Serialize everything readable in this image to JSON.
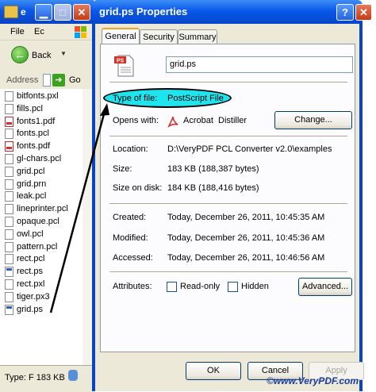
{
  "explorer": {
    "title": "e",
    "menu": [
      "File",
      "Ec"
    ],
    "back_label": "Back",
    "address_label": "Address",
    "go_label": "Go",
    "files": [
      {
        "name": "bitfonts.pxl",
        "icon": "doc"
      },
      {
        "name": "fills.pcl",
        "icon": "doc"
      },
      {
        "name": "fonts1.pdf",
        "icon": "pdf"
      },
      {
        "name": "fonts.pcl",
        "icon": "doc"
      },
      {
        "name": "fonts.pdf",
        "icon": "pdf"
      },
      {
        "name": "gl-chars.pcl",
        "icon": "doc"
      },
      {
        "name": "grid.pcl",
        "icon": "doc"
      },
      {
        "name": "grid.prn",
        "icon": "doc"
      },
      {
        "name": "leak.pcl",
        "icon": "doc"
      },
      {
        "name": "lineprinter.pcl",
        "icon": "doc"
      },
      {
        "name": "opaque.pcl",
        "icon": "doc"
      },
      {
        "name": "owl.pcl",
        "icon": "doc"
      },
      {
        "name": "pattern.pcl",
        "icon": "doc"
      },
      {
        "name": "rect.pcl",
        "icon": "doc"
      },
      {
        "name": "rect.ps",
        "icon": "ps"
      },
      {
        "name": "rect.pxl",
        "icon": "doc"
      },
      {
        "name": "tiger.px3",
        "icon": "doc"
      },
      {
        "name": "grid.ps",
        "icon": "ps"
      }
    ],
    "status": "Type: F 183 KB"
  },
  "dialog": {
    "title": "grid.ps Properties",
    "help_label": "?",
    "close_label": "✕",
    "tabs": [
      "General",
      "Security",
      "Summary"
    ],
    "active_tab": 0,
    "file_name": "grid.ps",
    "icon_badge": "PS",
    "type_label": "Type of file:",
    "type_value": "PostScript File",
    "opens_label": "Opens with:",
    "opens_value": "Acrobat  Distiller",
    "change_label": "Change...",
    "location_label": "Location:",
    "location_value": "D:\\VeryPDF PCL Converter v2.0\\examples",
    "size_label": "Size:",
    "size_value": "183 KB (188,387 bytes)",
    "size_disk_label": "Size on disk:",
    "size_disk_value": "184 KB (188,416 bytes)",
    "created_label": "Created:",
    "created_value": "Today, December 26, 2011, 10:45:35 AM",
    "modified_label": "Modified:",
    "modified_value": "Today, December 26, 2011, 10:45:36 AM",
    "accessed_label": "Accessed:",
    "accessed_value": "Today, December 26, 2011, 10:46:56 AM",
    "attributes_label": "Attributes:",
    "readonly_label": "Read-only",
    "hidden_label": "Hidden",
    "advanced_label": "Advanced...",
    "ok_label": "OK",
    "cancel_label": "Cancel",
    "apply_label": "Apply"
  },
  "watermark": "©www.VeryPDF.com",
  "colors": {
    "highlight": "#1ee4ee",
    "titlebar": "#0a58ea",
    "dialog_face": "#ece9d8"
  }
}
